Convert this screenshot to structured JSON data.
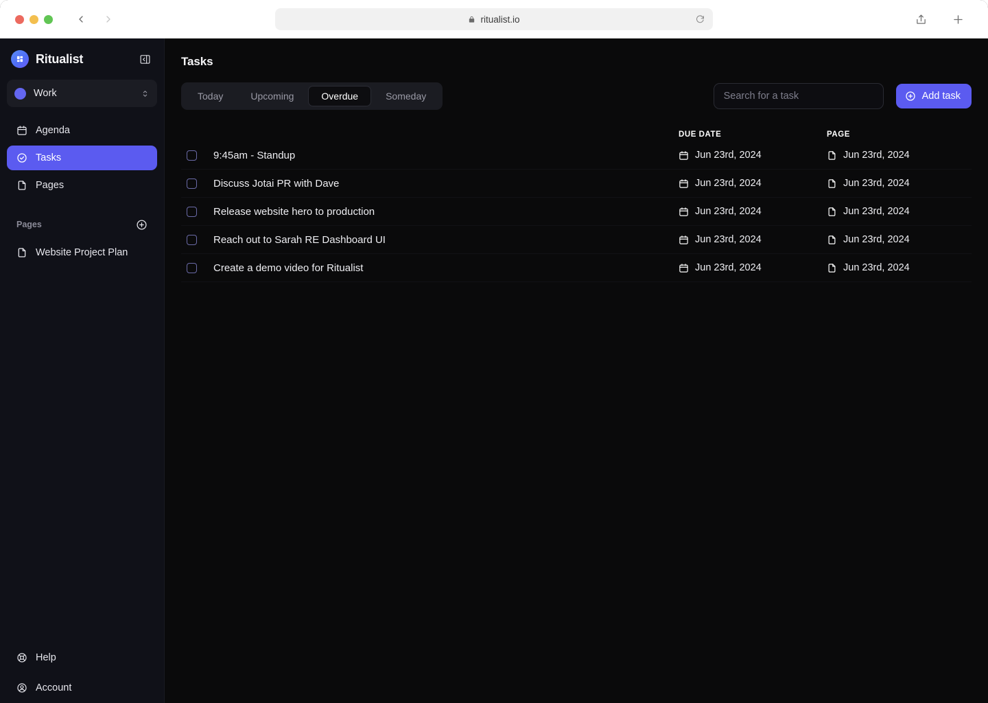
{
  "browser": {
    "url": "ritualist.io",
    "lock_icon": "lock-icon",
    "back_icon": "chevron-left-icon",
    "forward_icon": "chevron-right-icon",
    "reload_icon": "reload-icon",
    "share_icon": "share-icon",
    "new_tab_icon": "plus-icon",
    "traffic_lights": [
      "close-button",
      "minimize-button",
      "zoom-button"
    ]
  },
  "sidebar": {
    "brand": {
      "name": "Ritualist",
      "logo_icon": "ritualist-logo-icon",
      "collapse_icon": "collapse-sidebar-icon"
    },
    "workspace": {
      "name": "Work",
      "dot_color": "#6366f1",
      "chevron_icon": "chevron-up-down-icon"
    },
    "nav": [
      {
        "label": "Agenda",
        "icon": "calendar-icon",
        "active": false
      },
      {
        "label": "Tasks",
        "icon": "check-circle-icon",
        "active": true
      },
      {
        "label": "Pages",
        "icon": "file-icon",
        "active": false
      }
    ],
    "pages_section": {
      "title": "Pages",
      "add_icon": "plus-circle-icon",
      "items": [
        {
          "label": "Website Project Plan",
          "icon": "file-icon"
        }
      ]
    },
    "footer": [
      {
        "label": "Help",
        "icon": "lifebuoy-icon"
      },
      {
        "label": "Account",
        "icon": "user-circle-icon"
      }
    ]
  },
  "main": {
    "title": "Tasks",
    "tabs": [
      {
        "label": "Today",
        "active": false
      },
      {
        "label": "Upcoming",
        "active": false
      },
      {
        "label": "Overdue",
        "active": true
      },
      {
        "label": "Someday",
        "active": false
      }
    ],
    "search": {
      "placeholder": "Search for a task",
      "value": ""
    },
    "add_task": {
      "label": "Add task",
      "icon": "plus-circle-icon"
    },
    "columns": {
      "due_date": "DUE DATE",
      "page": "PAGE"
    },
    "tasks": [
      {
        "title": "9:45am - Standup",
        "checked": false,
        "due_date": "Jun 23rd, 2024",
        "page": "Jun 23rd, 2024"
      },
      {
        "title": "Discuss Jotai PR with Dave",
        "checked": false,
        "due_date": "Jun 23rd, 2024",
        "page": "Jun 23rd, 2024"
      },
      {
        "title": "Release website hero to production",
        "checked": false,
        "due_date": "Jun 23rd, 2024",
        "page": "Jun 23rd, 2024"
      },
      {
        "title": "Reach out to Sarah RE Dashboard UI",
        "checked": false,
        "due_date": "Jun 23rd, 2024",
        "page": "Jun 23rd, 2024"
      },
      {
        "title": "Create a demo video for Ritualist",
        "checked": false,
        "due_date": "Jun 23rd, 2024",
        "page": "Jun 23rd, 2024"
      }
    ]
  },
  "colors": {
    "accent": "#5b5bf0",
    "sidebar_bg": "#101118",
    "main_bg": "#0a0a0b",
    "workspace_bg": "#1b1c23",
    "segmented_bg": "#1b1c22"
  }
}
